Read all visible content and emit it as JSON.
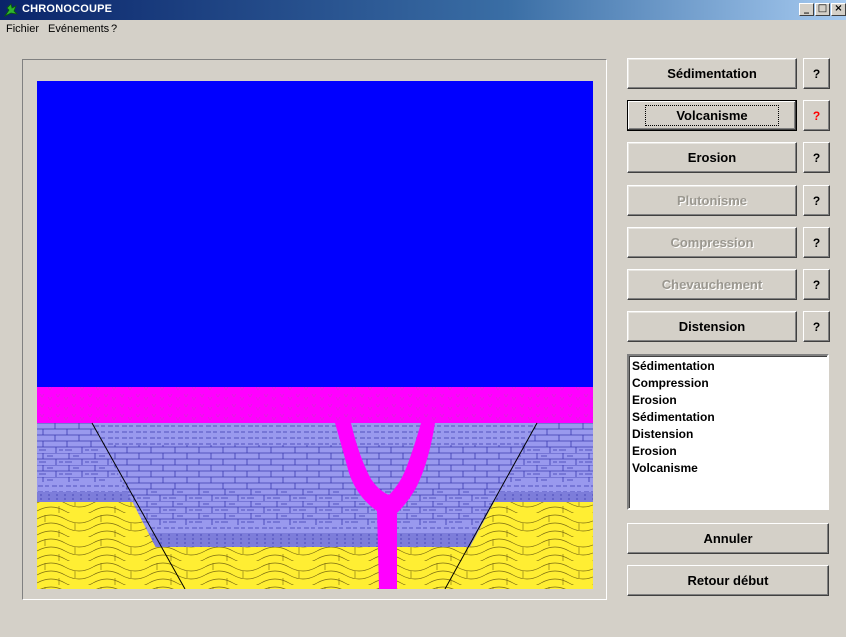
{
  "window": {
    "title": "CHRONOCOUPE",
    "minimize_label": "_",
    "maximize_label": "□",
    "close_label": "×"
  },
  "menu": {
    "items": [
      {
        "label": "Fichier"
      },
      {
        "label": "Evénements"
      },
      {
        "label": "?"
      }
    ]
  },
  "events": [
    {
      "label": "Sédimentation",
      "enabled": true
    },
    {
      "label": "Volcanisme",
      "enabled": true
    },
    {
      "label": "Erosion",
      "enabled": true
    },
    {
      "label": "Plutonisme",
      "enabled": false
    },
    {
      "label": "Compression",
      "enabled": false
    },
    {
      "label": "Chevauchement",
      "enabled": false
    },
    {
      "label": "Distension",
      "enabled": true
    }
  ],
  "help_label": "?",
  "history": [
    "Sédimentation",
    "Compression",
    "Erosion",
    "Sédimentation",
    "Distension",
    "Erosion",
    "Volcanisme"
  ],
  "actions": {
    "undo_label": "Annuler",
    "restart_label": "Retour début"
  },
  "colors": {
    "sky": "#0000ff",
    "volcanic_layer": "#ff00ff",
    "limestone": "#9999ee",
    "sandstone": "#ffee33",
    "help_active": "#ff0000"
  }
}
